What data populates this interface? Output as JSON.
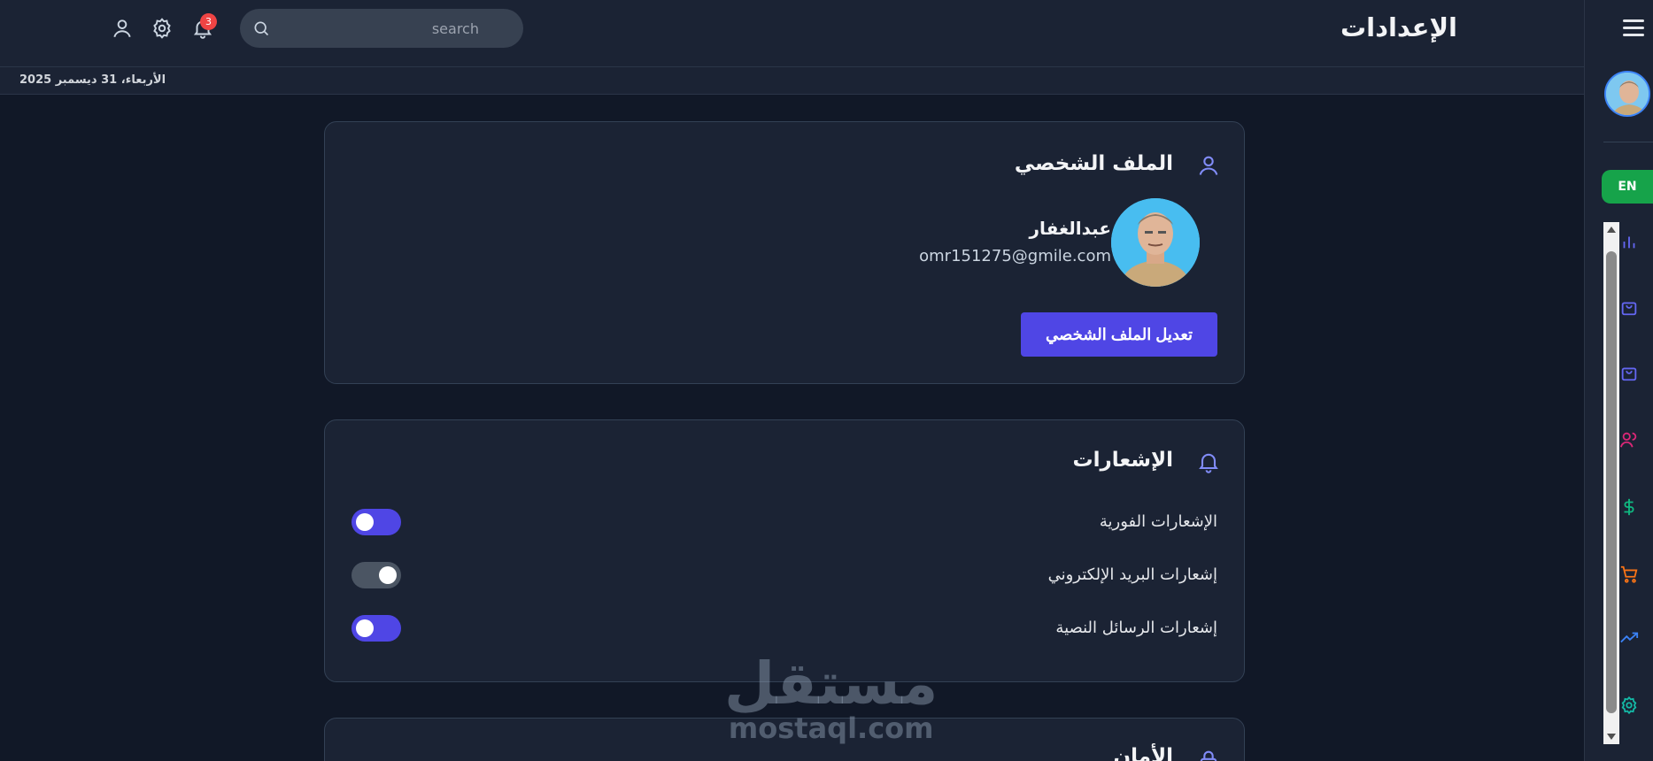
{
  "header": {
    "title": "الإعدادات",
    "search_placeholder": "search",
    "notification_count": "3"
  },
  "datebar": {
    "date": "الأربعاء، 31 ديسمبر 2025"
  },
  "sidebar": {
    "language_button": "EN",
    "icons": [
      "menu-icon",
      "chart-icon",
      "bag-icon",
      "bag-icon",
      "users-icon",
      "dollar-icon",
      "cart-icon",
      "trend-icon",
      "gear-icon"
    ]
  },
  "profile": {
    "section_title": "الملف الشخصي",
    "name": "عبدالغفار",
    "email": "omr151275@gmile.com",
    "edit_button": "تعديل الملف الشخصي"
  },
  "notifications": {
    "section_title": "الإشعارات",
    "items": [
      {
        "label": "الإشعارات الفورية",
        "enabled": false
      },
      {
        "label": "إشعارات البريد الإلكتروني",
        "enabled": true
      },
      {
        "label": "إشعارات الرسائل النصية",
        "enabled": false
      }
    ]
  },
  "security": {
    "section_title": "الأمان"
  },
  "watermark": {
    "arabic": "مستقل",
    "latin": "mostaql.com"
  },
  "colors": {
    "background": "#111827",
    "panel": "#1b2334",
    "accent": "#4f46e5",
    "success": "#16a34a",
    "badge": "#ef4444"
  }
}
